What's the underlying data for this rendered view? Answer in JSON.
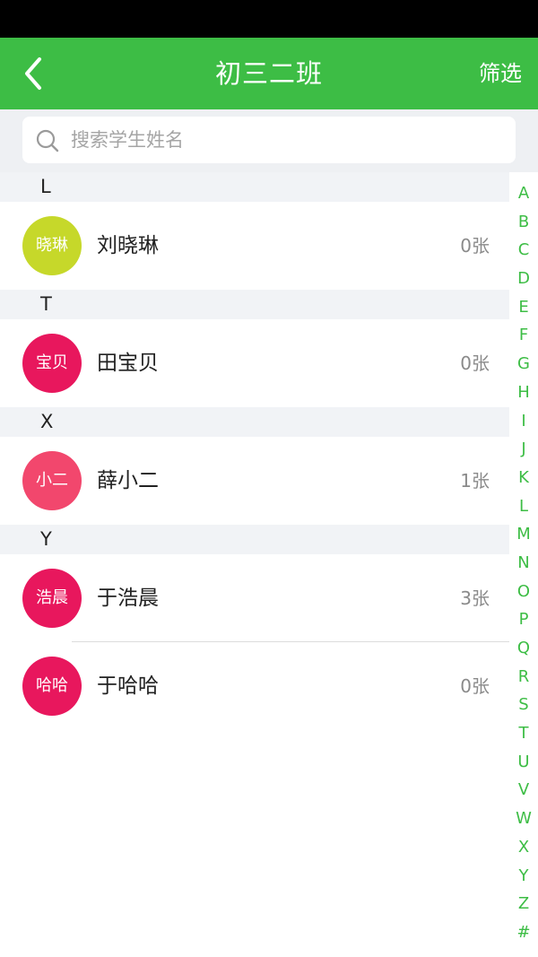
{
  "header": {
    "title": "初三二班",
    "filter_label": "筛选"
  },
  "search": {
    "placeholder": "搜索学生姓名"
  },
  "colors": {
    "accent": "#3dbd45",
    "avatar_lime": "#c6d82a",
    "avatar_crimson": "#e8175d",
    "avatar_pink": "#f2476d"
  },
  "sections": [
    {
      "letter": "L",
      "students": [
        {
          "avatar_text": "晓琳",
          "name": "刘晓琳",
          "count": "0张",
          "avatar_color": "#c6d82a"
        }
      ]
    },
    {
      "letter": "T",
      "students": [
        {
          "avatar_text": "宝贝",
          "name": "田宝贝",
          "count": "0张",
          "avatar_color": "#e8175d"
        }
      ]
    },
    {
      "letter": "X",
      "students": [
        {
          "avatar_text": "小二",
          "name": "薛小二",
          "count": "1张",
          "avatar_color": "#f2476d"
        }
      ]
    },
    {
      "letter": "Y",
      "students": [
        {
          "avatar_text": "浩晨",
          "name": "于浩晨",
          "count": "3张",
          "avatar_color": "#e8175d"
        },
        {
          "avatar_text": "哈哈",
          "name": "于哈哈",
          "count": "0张",
          "avatar_color": "#e8175d"
        }
      ]
    }
  ],
  "index_letters": [
    "A",
    "B",
    "C",
    "D",
    "E",
    "F",
    "G",
    "H",
    "I",
    "J",
    "K",
    "L",
    "M",
    "N",
    "O",
    "P",
    "Q",
    "R",
    "S",
    "T",
    "U",
    "V",
    "W",
    "X",
    "Y",
    "Z",
    "#"
  ]
}
